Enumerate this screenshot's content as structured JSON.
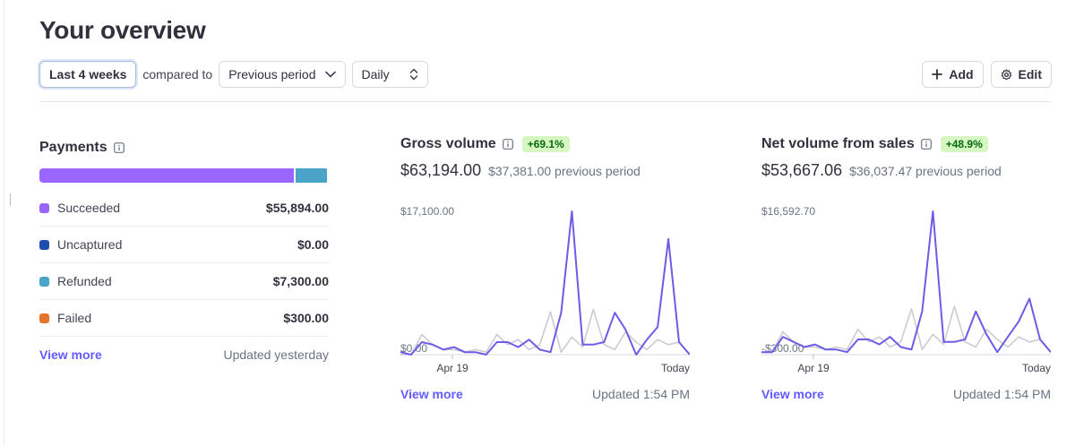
{
  "page": {
    "title": "Your overview"
  },
  "toolbar": {
    "range_label": "Last 4 weeks",
    "compared_to": "compared to",
    "comparison_label": "Previous period",
    "interval_label": "Daily",
    "add_label": "Add",
    "edit_label": "Edit"
  },
  "payments": {
    "title": "Payments",
    "items": [
      {
        "label": "Succeeded",
        "amount": "$55,894.00",
        "value": 55894.0,
        "color": "#9966ff"
      },
      {
        "label": "Uncaptured",
        "amount": "$0.00",
        "value": 0.0,
        "color": "#1f4fae"
      },
      {
        "label": "Refunded",
        "amount": "$7,300.00",
        "value": 7300.0,
        "color": "#4ba3c7"
      },
      {
        "label": "Failed",
        "amount": "$300.00",
        "value": 300.0,
        "color": "#e5732b"
      }
    ],
    "view_more": "View more",
    "updated": "Updated yesterday"
  },
  "gross": {
    "title": "Gross volume",
    "change": "+69.1%",
    "amount": "$63,194.00",
    "previous": "$37,381.00 previous period",
    "y_max_label": "$17,100.00",
    "y_min_label": "$0.00",
    "x_start": "Apr 19",
    "x_end": "Today",
    "view_more": "View more",
    "updated": "Updated 1:54 PM"
  },
  "net": {
    "title": "Net volume from sales",
    "change": "+48.9%",
    "amount": "$53,667.06",
    "previous": "$36,037.47 previous period",
    "y_max_label": "$16,592.70",
    "y_min_label": "-$300.00",
    "x_start": "Apr 19",
    "x_end": "Today",
    "view_more": "View more",
    "updated": "Updated 1:54 PM"
  },
  "colors": {
    "current_line": "#6c5ce7",
    "previous_line": "#c9ccd1",
    "accent_link": "#635bff",
    "badge_bg": "#d7f7c2",
    "badge_text": "#05690d"
  },
  "chart_data": [
    {
      "type": "line",
      "title": "Gross volume",
      "x_start": "Apr 19",
      "x_end": "Today",
      "ylim": [
        0,
        17100
      ],
      "series": [
        {
          "values": [
            300,
            0,
            1500,
            1200,
            600,
            900,
            300,
            300,
            0,
            1500,
            1500,
            900,
            1800,
            600,
            300,
            5000,
            17100,
            1200,
            1200,
            1500,
            5000,
            3000,
            0,
            1800,
            3300,
            13800,
            1500,
            0
          ]
        },
        {
          "values": [
            0,
            0,
            2400,
            1200,
            600,
            600,
            300,
            600,
            300,
            2400,
            1200,
            1800,
            600,
            1200,
            5100,
            300,
            2100,
            900,
            5400,
            1200,
            600,
            2700,
            1500,
            600,
            1800,
            1200,
            1500,
            0
          ]
        }
      ]
    },
    {
      "type": "line",
      "title": "Net volume from sales",
      "x_start": "Apr 19",
      "x_end": "Today",
      "ylim": [
        -300,
        16592.7
      ],
      "series": [
        {
          "values": [
            0,
            0,
            1800,
            1200,
            600,
            900,
            300,
            300,
            0,
            1500,
            1500,
            900,
            1800,
            600,
            300,
            4800,
            16592.7,
            1200,
            1200,
            1500,
            4800,
            2100,
            0,
            1800,
            3600,
            6300,
            1500,
            0
          ]
        },
        {
          "values": [
            0,
            0,
            2400,
            1200,
            600,
            600,
            300,
            600,
            300,
            2700,
            1200,
            1800,
            600,
            1200,
            5100,
            300,
            2100,
            900,
            5400,
            1200,
            600,
            2700,
            1500,
            600,
            1800,
            1200,
            1500,
            0
          ]
        }
      ]
    }
  ]
}
